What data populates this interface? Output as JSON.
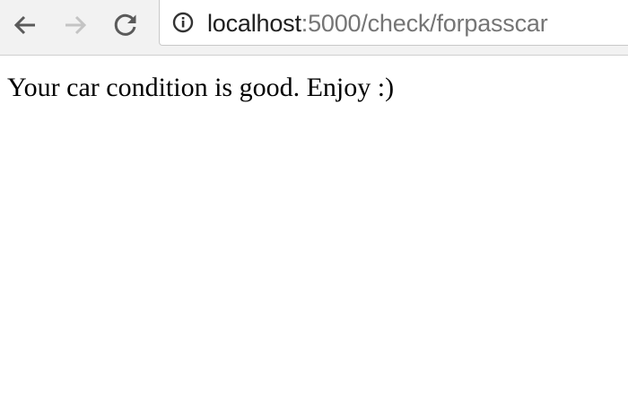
{
  "browser": {
    "address_bar": {
      "host": "localhost",
      "path": ":5000/check/forpasscar",
      "info_icon": "info-circle-icon"
    },
    "buttons": {
      "back_icon": "arrow-left-icon",
      "forward_icon": "arrow-right-icon",
      "reload_icon": "reload-icon"
    },
    "colors": {
      "toolbar_bg": "#f2f2f2",
      "icon_active": "#5a5a5a",
      "icon_disabled": "#c4c4c4",
      "url_host": "#202020",
      "url_path": "#757575"
    }
  },
  "page": {
    "message": "Your car condition is good. Enjoy :)"
  }
}
